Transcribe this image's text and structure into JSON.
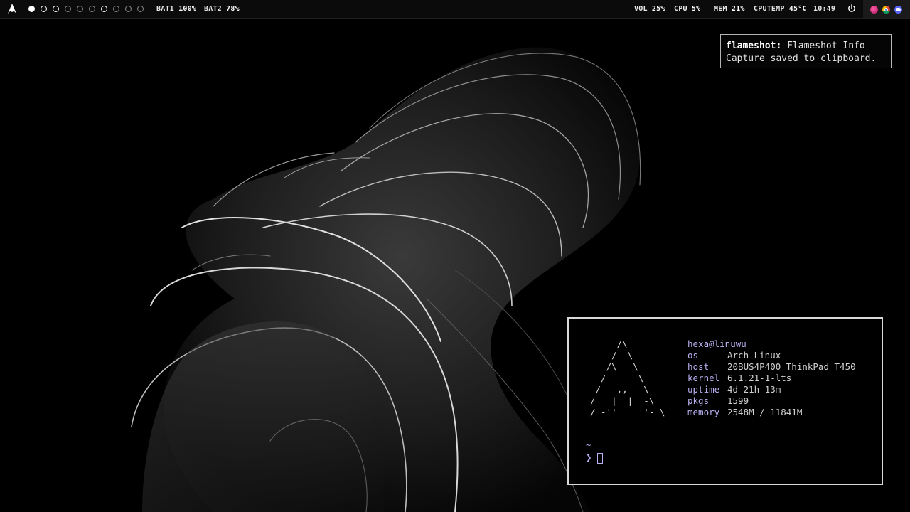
{
  "bar": {
    "workspaces": [
      {
        "state": "active"
      },
      {
        "state": "occupied"
      },
      {
        "state": "occupied"
      },
      {
        "state": "empty"
      },
      {
        "state": "empty"
      },
      {
        "state": "empty"
      },
      {
        "state": "occupied"
      },
      {
        "state": "empty"
      },
      {
        "state": "empty"
      },
      {
        "state": "empty"
      }
    ],
    "bat1": {
      "label": "BAT1",
      "value": "100%"
    },
    "bat2": {
      "label": "BAT2",
      "value": "78%"
    },
    "vol": {
      "label": "VOL",
      "value": "25%"
    },
    "cpu": {
      "label": "CPU",
      "value": "5%"
    },
    "mem": {
      "label": "MEM",
      "value": "21%"
    },
    "cputemp": {
      "label": "CPUTEMP",
      "value": "45°C"
    },
    "clock": "10:49",
    "icons": {
      "launcher": "arch-logo-icon",
      "power": "power-icon",
      "tray": [
        "app-tray-icon-pink",
        "chrome-icon",
        "discord-icon"
      ]
    },
    "colors": {
      "tray_pink": "#d6237a",
      "discord": "#5865f2"
    }
  },
  "notification": {
    "app": "flameshot:",
    "summary": "Flameshot Info",
    "body": "Capture saved to clipboard."
  },
  "terminal": {
    "ascii_art": "     /\\\n    /  \\\n   /\\   \\\n  /      \\\n /   ,,   \\\n/   |  |  -\\\n/_-''    ''-_\\",
    "user_host": "hexa@linuwu",
    "fetch": [
      {
        "key": "os",
        "value": "Arch Linux"
      },
      {
        "key": "host",
        "value": "20BUS4P400 ThinkPad T450"
      },
      {
        "key": "kernel",
        "value": "6.1.21-1-lts"
      },
      {
        "key": "uptime",
        "value": "4d 21h 13m"
      },
      {
        "key": "pkgs",
        "value": "1599"
      },
      {
        "key": "memory",
        "value": "2548M / 11841M"
      }
    ],
    "cwd": "~",
    "prompt_symbol": "❯",
    "colors": {
      "accent": "#b8b0f0"
    }
  }
}
